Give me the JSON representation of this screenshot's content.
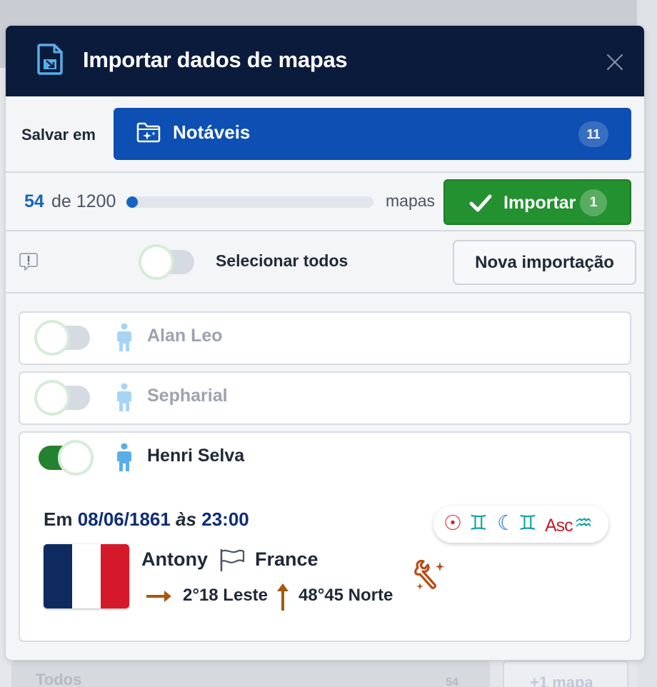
{
  "background": {
    "folder_label": "Todos",
    "folder_count": "54",
    "add_label": "+1 mapa"
  },
  "modal": {
    "title": "Importar dados de mapas",
    "save": {
      "label": "Salvar em",
      "folder_name": "Notáveis",
      "folder_count": "11"
    },
    "progress": {
      "count": "54",
      "rest": "de 1200",
      "fraction": 0.045,
      "unit": "mapas"
    },
    "import_button": {
      "label": "Importar",
      "badge": "1"
    },
    "select_all": {
      "label": "Selecionar todos",
      "checked": false
    },
    "new_import_label": "Nova importação",
    "people": [
      {
        "name": "Alan Leo",
        "selected": false
      },
      {
        "name": "Sepharial",
        "selected": false
      },
      {
        "name": "Henri Selva",
        "selected": true
      }
    ],
    "detail": {
      "prefix": "Em",
      "date": "08/06/1861",
      "at": "às",
      "time": "23:00",
      "city": "Antony",
      "country": "France",
      "longitude": "2°18 Leste",
      "latitude": "48°45 Norte",
      "astro": {
        "sun": "☉",
        "sun_sign": "♊",
        "moon": "☾",
        "moon_sign": "♊",
        "asc_label": "Asc",
        "asc_sign": "♒"
      }
    }
  },
  "colors": {
    "header_bg": "#0b1b3c",
    "folder_btn": "#0d4fb3",
    "import_btn": "#23912f",
    "accent_blue": "#1565c0",
    "date_blue": "#0e2d78",
    "person_icon": "#5aaee8",
    "arrow_brown": "#b5651d"
  }
}
